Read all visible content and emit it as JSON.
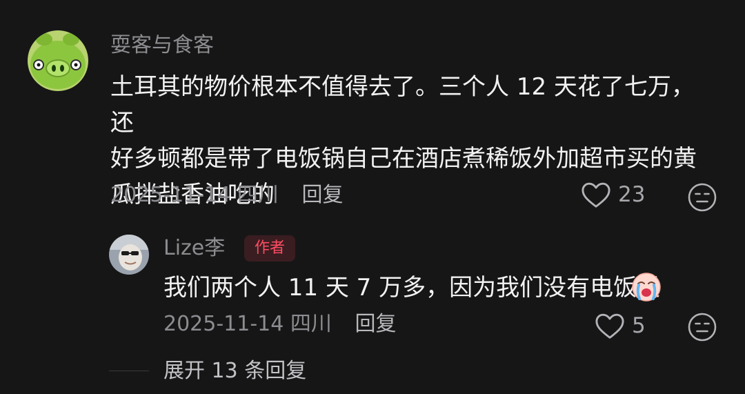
{
  "comment": {
    "username": "耍客与食客",
    "text": "土耳其的物价根本不值得去了。三个人 12 天花了七万，还\n好多顿都是带了电饭锅自己在酒店煮稀饭外加超市买的黄\n瓜拌盐香油吃的",
    "date": "2025-11-14",
    "location": "四川",
    "reply_label": "回复",
    "likes": "23",
    "avatar_icon": "green-pig-avatar",
    "like_icon": "heart-outline-icon",
    "dislike_icon": "meh-face-icon"
  },
  "reply": {
    "username": "Lize李",
    "badge": "作者",
    "text": "我们两个人 11 天 7 万多，因为我们没有电饭煲",
    "emoji": "crying-face-emoji",
    "date": "2025-11-14",
    "location": "四川",
    "reply_label": "回复",
    "likes": "5"
  },
  "expand": {
    "label": "展开 13 条回复"
  },
  "colors": {
    "background": "#161617",
    "primary_text": "#f2f2f3",
    "secondary_text": "#8d8d91",
    "author_badge_text": "#ff4d63",
    "author_badge_bg": "#3a1d21"
  }
}
